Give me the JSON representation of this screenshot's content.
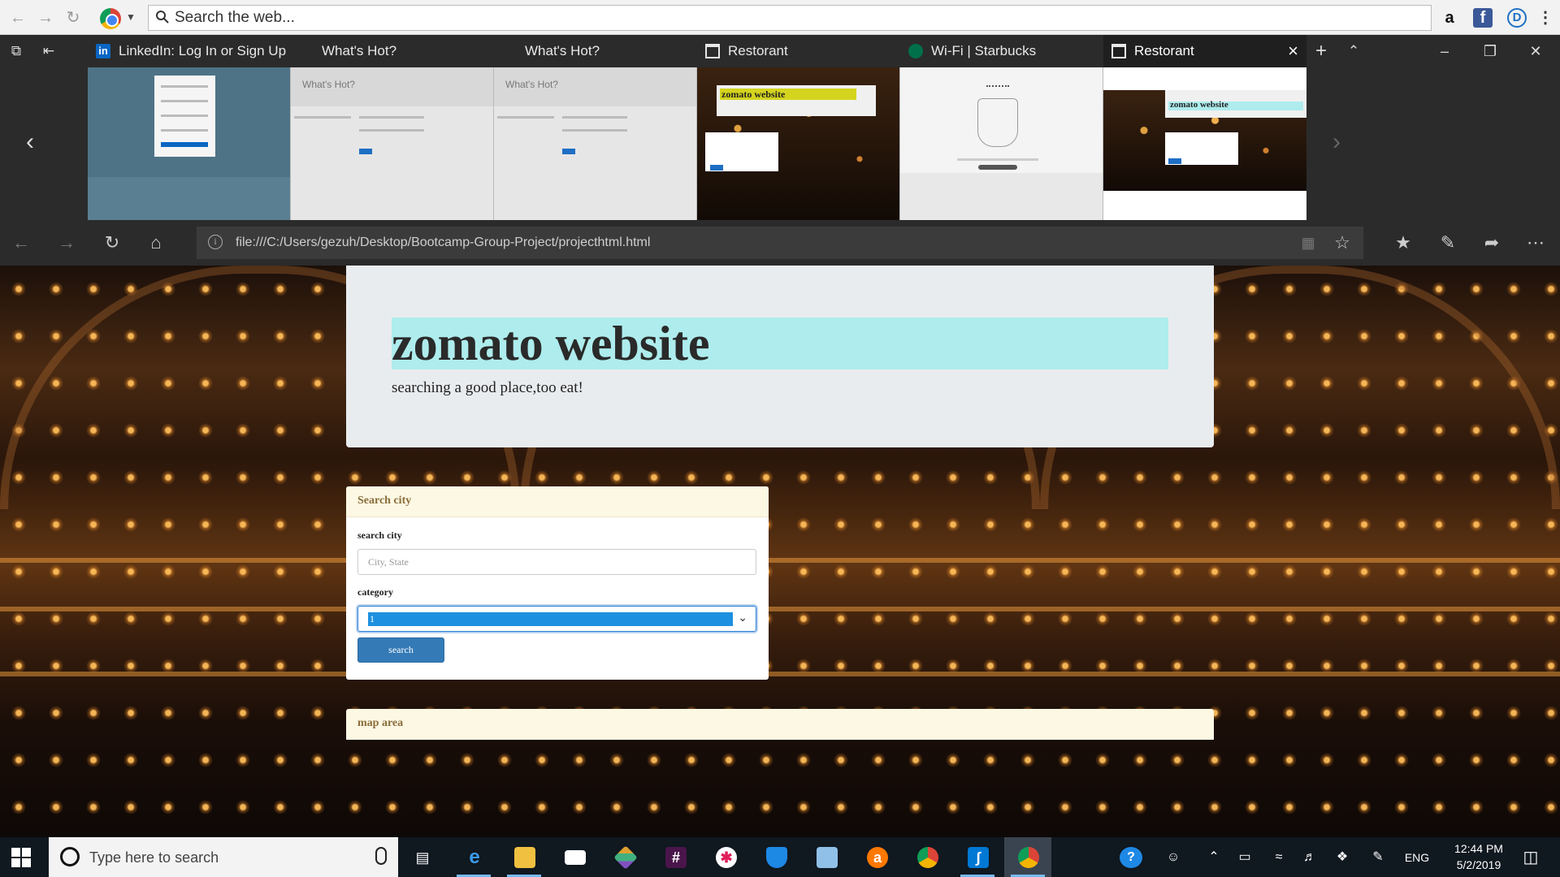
{
  "topbar": {
    "search_placeholder": "Search the web..."
  },
  "tabs": [
    {
      "label": "LinkedIn: Log In or Sign Up",
      "icon": "linkedin-icon"
    },
    {
      "label": "What's Hot?",
      "icon": ""
    },
    {
      "label": "What's Hot?",
      "icon": ""
    },
    {
      "label": "Restorant",
      "icon": "window-icon"
    },
    {
      "label": "Wi-Fi | Starbucks",
      "icon": "starbucks-icon"
    },
    {
      "label": "Restorant",
      "icon": "window-icon",
      "active": true
    }
  ],
  "previews": {
    "whats_hot_title": "What's Hot?",
    "zomato_title": "zomato website"
  },
  "address": {
    "url": "file:///C:/Users/gezuh/Desktop/Bootcamp-Group-Project/projecthtml.html"
  },
  "page": {
    "title": "zomato website",
    "tagline": "searching a good place,too eat!",
    "search_panel": {
      "heading": "Search city",
      "city_label": "search city",
      "city_placeholder": "City, State",
      "category_label": "category",
      "category_value": "1",
      "button_label": "search"
    },
    "map_panel": {
      "heading": "map area"
    }
  },
  "taskbar": {
    "search_placeholder": "Type here to search",
    "language": "ENG",
    "time": "12:44 PM",
    "date": "5/2/2019"
  },
  "colors": {
    "title_highlight": "#aeeced",
    "panel_heading_bg": "#fcf8e3",
    "panel_heading_text": "#8a6d3b",
    "primary_button": "#337ab7",
    "select_highlight": "#1e90e0",
    "edge_chrome": "#2b2b2b",
    "taskbar": "#101820"
  }
}
